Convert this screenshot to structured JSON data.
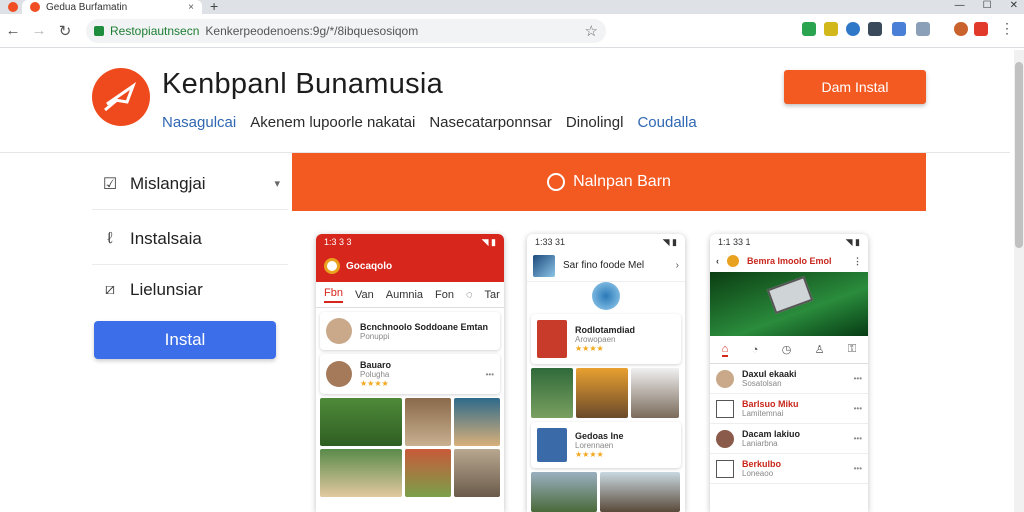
{
  "browser": {
    "tab_title": "Gedua Burfamatin",
    "tab_close": "×",
    "new_tab": "+",
    "url_host": "Restopiautnsecn",
    "url_path": "Kenkerpeodenoens:9g/*/8ibquesosiqom",
    "win_min": "—",
    "win_max": "☐",
    "win_close": "✕"
  },
  "header": {
    "title": "Kenbpanl Bunamusia",
    "nav": [
      "Nasagulcai",
      "Akenem lupoorle nakatai",
      "Nasecatarponnsar",
      "Dinolingl",
      "Coudalla"
    ],
    "install_label": "Dam Instal"
  },
  "sidebar": {
    "items": [
      {
        "label": "Mislangjai",
        "icon": "check-box-icon"
      },
      {
        "label": "Instalsaia",
        "icon": "link-icon"
      },
      {
        "label": "Lielunsiar",
        "icon": "image-icon"
      }
    ],
    "install_label": "Instal"
  },
  "banner": {
    "label": "Nalnpan Barn"
  },
  "phone1": {
    "time": "1:3 3 3",
    "status_icons": "◥ ▮",
    "app_name": "Gocaqolo",
    "tabs": [
      "Fbn",
      "Van",
      "Aumnia",
      "Fon",
      "◌",
      "Tar"
    ],
    "card1_title": "Bcnchnoolo Soddoane Emtan",
    "card1_sub": "Ponuppi",
    "card2_title": "Bauaro",
    "card2_sub": "Polugha",
    "card2_stars": "★★★★",
    "card2_dots": "•••"
  },
  "phone2": {
    "time": "1:33 31",
    "status_icons": "◥ ▮",
    "title": "Sar fino foode Mel",
    "card1_title": "Rodlotamdiad",
    "card1_sub": "Arowopaen",
    "card1_stars": "★★★★",
    "card2_title": "Gedoas Ine",
    "card2_sub": "Lorennaen",
    "card2_stars": "★★★★"
  },
  "phone3": {
    "time": "1:1 33 1",
    "status_icons": "◥ ▮",
    "title": "Bemra Imoolo Emol",
    "rows": [
      {
        "title": "Daxul ekaaki",
        "sub": "Sosatolsan",
        "dots": "•••"
      },
      {
        "title": "Barlsuo Miku",
        "sub": "Lamitemnai",
        "dots": "•••"
      },
      {
        "title": "Dacam lakiuo",
        "sub": "Laniarbna",
        "dots": "•••"
      },
      {
        "title": "Berkulbo",
        "sub": "Loneaoo",
        "dots": "•••"
      }
    ]
  },
  "colors": {
    "accent": "#f25a22",
    "primary_blue": "#3b6ee8",
    "app_red": "#d7261c"
  }
}
